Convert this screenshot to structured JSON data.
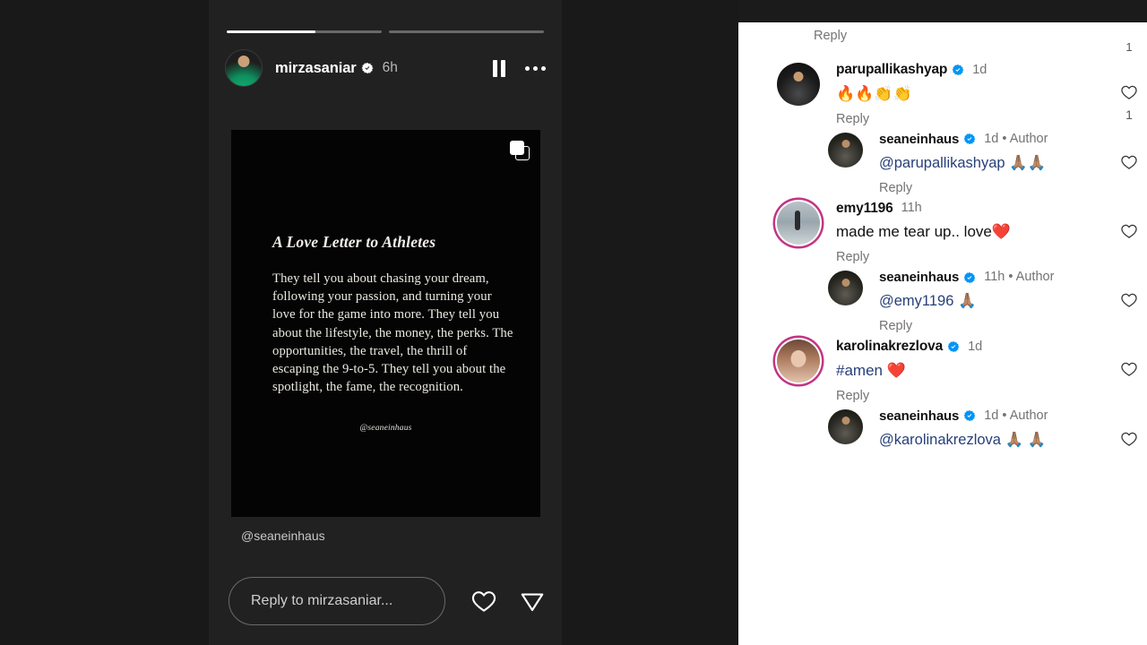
{
  "story": {
    "progress": [
      {
        "fill_percent": 57
      },
      {
        "fill_percent": 0
      }
    ],
    "username": "mirzasaniar",
    "verified": true,
    "time": "6h",
    "pause_label": "Pause",
    "more_label": "More options",
    "card": {
      "title": "A Love Letter to Athletes",
      "paragraph": "They tell you about chasing your dream, following your passion, and turning your love for the game into more. They tell you about the lifestyle, the money, the perks. The opportunities, the travel, the thrill of escaping the 9-to-5. They tell you about the spotlight, the fame, the recognition.",
      "signature": "@seaneinhaus",
      "carousel_icon": "multi-post-icon"
    },
    "attribution": "@seaneinhaus",
    "reply_placeholder": "Reply to mirzasaniar...",
    "like_icon": "heart-icon",
    "share_icon": "paper-plane-icon"
  },
  "comments": {
    "partial_top_reply_label": "Reply",
    "partial_top_like_count": "1",
    "items": [
      {
        "id": "c1",
        "level": "top",
        "avatar": "ava-paru",
        "ring": false,
        "username": "parupallikashyap",
        "verified": true,
        "time": "1d",
        "author_tag": "",
        "text": "🔥🔥👏👏",
        "mention": "",
        "hashtag": "",
        "reply_label": "Reply",
        "like_count": "1"
      },
      {
        "id": "c2",
        "level": "reply",
        "avatar": "ava-sean",
        "ring": false,
        "username": "seaneinhaus",
        "verified": true,
        "time": "1d",
        "author_tag": "• Author",
        "mention": "@parupallikashyap",
        "text": " 🙏🏽🙏🏽",
        "hashtag": "",
        "reply_label": "Reply",
        "like_count": ""
      },
      {
        "id": "c3",
        "level": "top",
        "avatar": "ava-emy",
        "ring": true,
        "username": "emy1196",
        "verified": false,
        "time": "11h",
        "author_tag": "",
        "mention": "",
        "text": "made me tear up.. love❤️",
        "hashtag": "",
        "reply_label": "Reply",
        "like_count": ""
      },
      {
        "id": "c4",
        "level": "reply",
        "avatar": "ava-sean",
        "ring": false,
        "username": "seaneinhaus",
        "verified": true,
        "time": "11h",
        "author_tag": "• Author",
        "mention": "@emy1196",
        "text": " 🙏🏽",
        "hashtag": "",
        "reply_label": "Reply",
        "like_count": ""
      },
      {
        "id": "c5",
        "level": "top",
        "avatar": "ava-karo",
        "ring": true,
        "username": "karolinakrezlova",
        "verified": true,
        "time": "1d",
        "author_tag": "",
        "mention": "",
        "hashtag": "#amen",
        "text": " ❤️",
        "reply_label": "Reply",
        "like_count": ""
      },
      {
        "id": "c6",
        "level": "reply",
        "avatar": "ava-sean",
        "ring": false,
        "username": "seaneinhaus",
        "verified": true,
        "time": "1d",
        "author_tag": "• Author",
        "mention": "@karolinakrezlova",
        "text": " 🙏🏽 🙏🏽",
        "hashtag": "",
        "reply_label": "",
        "like_count": ""
      }
    ]
  },
  "colors": {
    "verified_blue": "#0095f6",
    "link_blue": "#27407a",
    "story_bg": "#212121",
    "page_bg": "#1a1a1a",
    "comments_bg": "#ffffff",
    "meta_gray": "#737373"
  }
}
